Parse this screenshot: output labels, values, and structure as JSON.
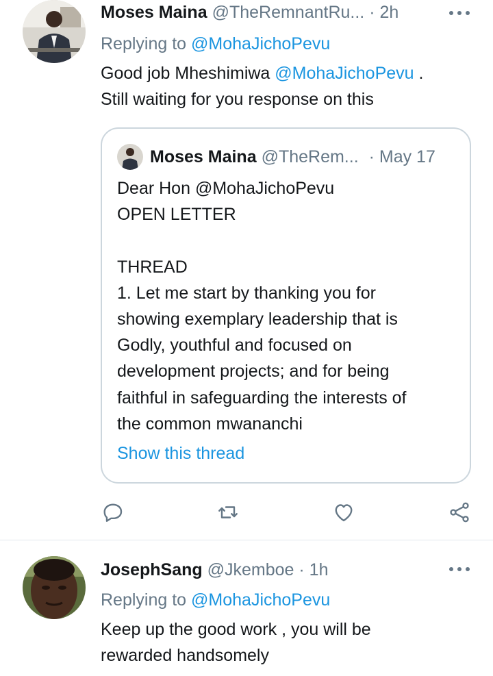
{
  "tweet1": {
    "name": "Moses Maina",
    "handle": "@TheRemnantRu...",
    "time": "· 2h",
    "replying_prefix": "Replying to ",
    "replying_mention": "@MohaJichoPevu",
    "body_line1_pre": "Good job Mheshimiwa ",
    "body_line1_mention": "@MohaJichoPevu",
    "body_line1_post": " .",
    "body_line2": "Still waiting for you response on this",
    "quote": {
      "name": "Moses Maina",
      "handle": "@TheRem...",
      "time": "· May 17",
      "text": "Dear Hon @MohaJichoPevu\nOPEN LETTER\n\nTHREAD\n1. Let me start by thanking you for\nshowing exemplary leadership that is\nGodly, youthful and focused on\ndevelopment projects; and for being\nfaithful in safeguarding the interests of\nthe common mwananchi",
      "show_thread": "Show this thread"
    },
    "actions": [
      "reply-icon",
      "retweet-icon",
      "like-icon",
      "share-icon"
    ]
  },
  "tweet2": {
    "name": "JosephSang",
    "handle": "@Jkemboe",
    "time": "· 1h",
    "replying_prefix": "Replying to ",
    "replying_mention": "@MohaJichoPevu",
    "body_line1": "Keep up the good work , you will be",
    "body_line2": "rewarded handsomely"
  },
  "colors": {
    "text": "#14171a",
    "secondary": "#657786",
    "link": "#1b95e0",
    "border": "#ccd6dd"
  }
}
